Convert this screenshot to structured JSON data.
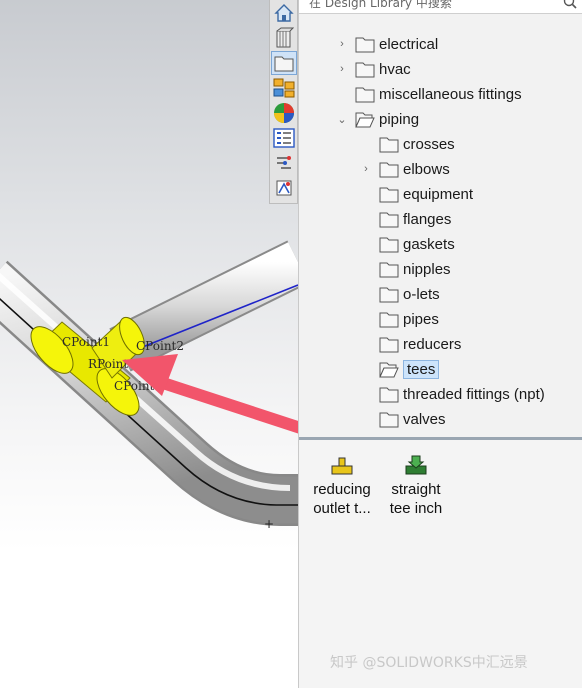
{
  "search": {
    "label": "在 Design Library 中搜索",
    "icon": "search-icon"
  },
  "viewport": {
    "points": [
      "CPoint1",
      "CPoint2",
      "RPoint",
      "CPoint3"
    ]
  },
  "tabs": [
    "home-icon",
    "parts-icon",
    "design-library-icon",
    "file-explorer-icon",
    "appearances-icon",
    "custom-properties-icon",
    "routing-icon",
    "library-icon"
  ],
  "tree": {
    "electrical": "electrical",
    "hvac": "hvac",
    "misc": "miscellaneous fittings",
    "piping": "piping",
    "crosses": "crosses",
    "elbows": "elbows",
    "equipment": "equipment",
    "flanges": "flanges",
    "gaskets": "gaskets",
    "nipples": "nipples",
    "olets": "o-lets",
    "pipes": "pipes",
    "reducers": "reducers",
    "tees": "tees",
    "threaded": "threaded fittings (npt)",
    "valves": "valves"
  },
  "preview": {
    "item1": {
      "line1": "reducing",
      "line2": "outlet t..."
    },
    "item2": {
      "line1": "straight",
      "line2": "tee inch"
    }
  },
  "watermark": "知乎 @SOLIDWORKS中汇远景",
  "colors": {
    "highlight": "#f5f50a",
    "arrow": "#f2556b",
    "sketch": "#1f24c8",
    "selection": "#cde4fb"
  }
}
